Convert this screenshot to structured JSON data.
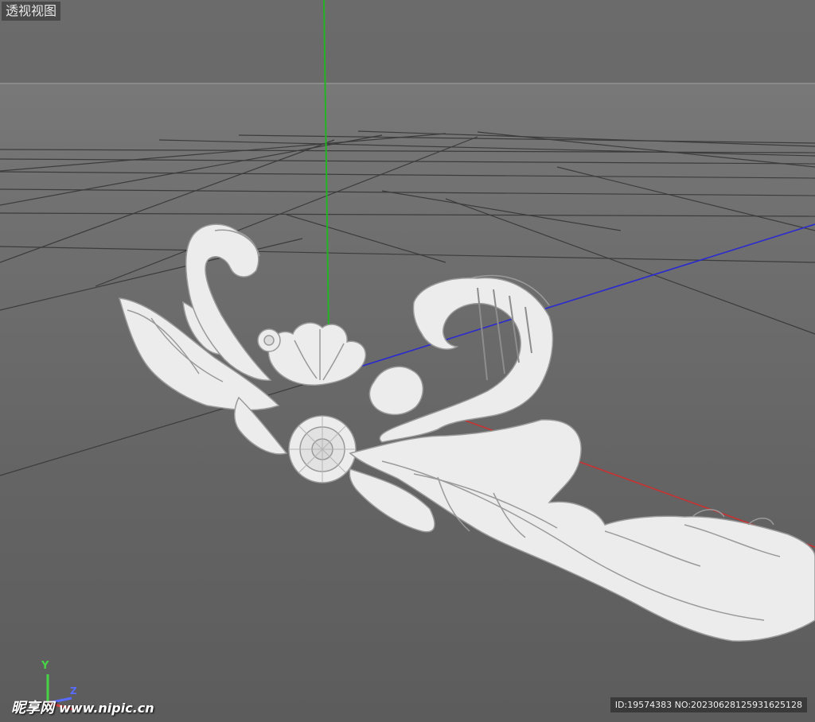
{
  "viewport": {
    "label": "透视视图",
    "axes": {
      "x_color": "#c83232",
      "y_color": "#22b422",
      "z_color": "#2a2ad0"
    }
  },
  "gizmo": {
    "y_label": "Y",
    "z_label": "Z"
  },
  "watermark": {
    "brand": "昵享网",
    "site": "www.nipic.cn"
  },
  "image_id": "ID:19574383 NO:20230628125931625128",
  "model": {
    "name": "carved-ornament",
    "color": "#ececec"
  }
}
